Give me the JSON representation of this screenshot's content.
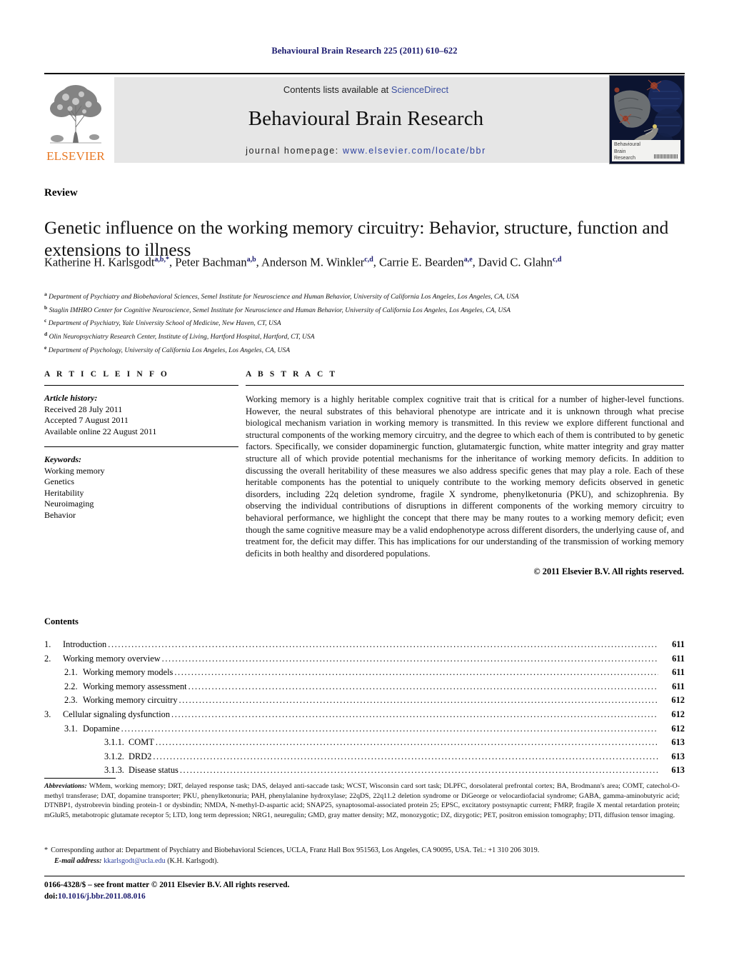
{
  "running_head": "Behavioural Brain Research 225 (2011) 610–622",
  "masthead": {
    "contents_prefix": "Contents lists available at ",
    "sciencedirect": "ScienceDirect",
    "journal_title": "Behavioural Brain Research",
    "homepage_label": "journal homepage: ",
    "homepage_url": "www.elsevier.com/locate/bbr",
    "publisher_name": "ELSEVIER",
    "publisher_color": "#e87722",
    "link_color": "#2b3f9e",
    "cover": {
      "line1": "Behavioural",
      "line2": "Brain",
      "line3": "Research"
    }
  },
  "article": {
    "type": "Review",
    "title": "Genetic influence on the working memory circuitry: Behavior, structure, function and extensions to illness",
    "authors": [
      {
        "name": "Katherine H. Karlsgodt",
        "sup": "a,b,*",
        "sep": ", "
      },
      {
        "name": "Peter Bachman",
        "sup": "a,b",
        "sep": ", "
      },
      {
        "name": "Anderson M. Winkler",
        "sup": "c,d",
        "sep": ", "
      },
      {
        "name": "Carrie E. Bearden",
        "sup": "a,e",
        "sep": ", "
      },
      {
        "name": "David C. Glahn",
        "sup": "c,d",
        "sep": ""
      }
    ],
    "affiliations": [
      {
        "sup": "a",
        "text": "Department of Psychiatry and Biobehavioral Sciences, Semel Institute for Neuroscience and Human Behavior, University of California Los Angeles, Los Angeles, CA, USA"
      },
      {
        "sup": "b",
        "text": "Staglin IMHRO Center for Cognitive Neuroscience, Semel Institute for Neuroscience and Human Behavior, University of California Los Angeles, Los Angeles, CA, USA"
      },
      {
        "sup": "c",
        "text": "Department of Psychiatry, Yale University School of Medicine, New Haven, CT, USA"
      },
      {
        "sup": "d",
        "text": "Olin Neuropsychiatry Research Center, Institute of Living, Hartford Hospital, Hartford, CT, USA"
      },
      {
        "sup": "e",
        "text": "Department of Psychology, University of California Los Angeles, Los Angeles, CA, USA"
      }
    ]
  },
  "article_info": {
    "heading": "A R T I C L E   I N F O",
    "history_label": "Article history:",
    "history": [
      "Received 28 July 2011",
      "Accepted 7 August 2011",
      "Available online 22 August 2011"
    ],
    "keywords_label": "Keywords:",
    "keywords": [
      "Working memory",
      "Genetics",
      "Heritability",
      "Neuroimaging",
      "Behavior"
    ]
  },
  "abstract": {
    "heading": "A B S T R A C T",
    "text": "Working memory is a highly heritable complex cognitive trait that is critical for a number of higher-level functions. However, the neural substrates of this behavioral phenotype are intricate and it is unknown through what precise biological mechanism variation in working memory is transmitted. In this review we explore different functional and structural components of the working memory circuitry, and the degree to which each of them is contributed to by genetic factors. Specifically, we consider dopaminergic function, glutamatergic function, white matter integrity and gray matter structure all of which provide potential mechanisms for the inheritance of working memory deficits. In addition to discussing the overall heritability of these measures we also address specific genes that may play a role. Each of these heritable components has the potential to uniquely contribute to the working memory deficits observed in genetic disorders, including 22q deletion syndrome, fragile X syndrome, phenylketonuria (PKU), and schizophrenia. By observing the individual contributions of disruptions in different components of the working memory circuitry to behavioral performance, we highlight the concept that there may be many routes to a working memory deficit; even though the same cognitive measure may be a valid endophenotype across different disorders, the underlying cause of, and treatment for, the deficit may differ. This has implications for our understanding of the transmission of working memory deficits in both healthy and disordered populations.",
    "copyright": "© 2011 Elsevier B.V. All rights reserved."
  },
  "contents": {
    "heading": "Contents",
    "items": [
      {
        "level": 1,
        "num": "1.",
        "label": "Introduction",
        "page": "611"
      },
      {
        "level": 1,
        "num": "2.",
        "label": "Working memory overview",
        "page": "611"
      },
      {
        "level": 2,
        "num": "2.1.",
        "label": "Working memory models",
        "page": "611"
      },
      {
        "level": 2,
        "num": "2.2.",
        "label": "Working memory assessment",
        "page": "611"
      },
      {
        "level": 2,
        "num": "2.3.",
        "label": "Working memory circuitry",
        "page": "612"
      },
      {
        "level": 1,
        "num": "3.",
        "label": "Cellular signaling dysfunction",
        "page": "612"
      },
      {
        "level": 2,
        "num": "3.1.",
        "label": "Dopamine",
        "page": "612"
      },
      {
        "level": 3,
        "num": "3.1.1.",
        "label": "COMT",
        "page": "613"
      },
      {
        "level": 3,
        "num": "3.1.2.",
        "label": "DRD2",
        "page": "613"
      },
      {
        "level": 3,
        "num": "3.1.3.",
        "label": "Disease status",
        "page": "613"
      }
    ]
  },
  "footnotes": {
    "abbreviations_label": "Abbreviations:",
    "abbreviations_text": " WMem, working memory; DRT, delayed response task; DAS, delayed anti-saccade task; WCST, Wisconsin card sort task; DLPFC, dorsolateral prefrontal cortex; BA, Brodmann's area; COMT, catechol-O-methyl transferase; DAT, dopamine transporter; PKU, phenylketonuria; PAH, phenylalanine hydroxylase; 22qDS, 22q11.2 deletion syndrome or DiGeorge or velocardiofacial syndrome; GABA, gamma-aminobutyric acid; DTNBP1, dystrobrevin binding protein-1 or dysbindin; NMDA, N-methyl-D-aspartic acid; SNAP25, synaptosomal-associated protein 25; EPSC, excitatory postsynaptic current; FMRP, fragile X mental retardation protein; mGluR5, metabotropic glutamate receptor 5; LTD, long term depression; NRG1, neuregulin; GMD, gray matter density; MZ, monozygotic; DZ, dizygotic; PET, positron emission tomography; DTI, diffusion tensor imaging.",
    "corresponding_star": "*",
    "corresponding_text": "Corresponding author at: Department of Psychiatry and Biobehavioral Sciences, UCLA, Franz Hall Box 951563, Los Angeles, CA 90095, USA. Tel.: +1 310 206 3019.",
    "email_label": "E-mail address:",
    "email": "kkarlsgodt@ucla.edu",
    "email_owner": "(K.H. Karlsgodt).",
    "imprint_line": "0166-4328/$ – see front matter © 2011 Elsevier B.V. All rights reserved.",
    "doi_label": "doi:",
    "doi_value": "10.1016/j.bbr.2011.08.016"
  }
}
